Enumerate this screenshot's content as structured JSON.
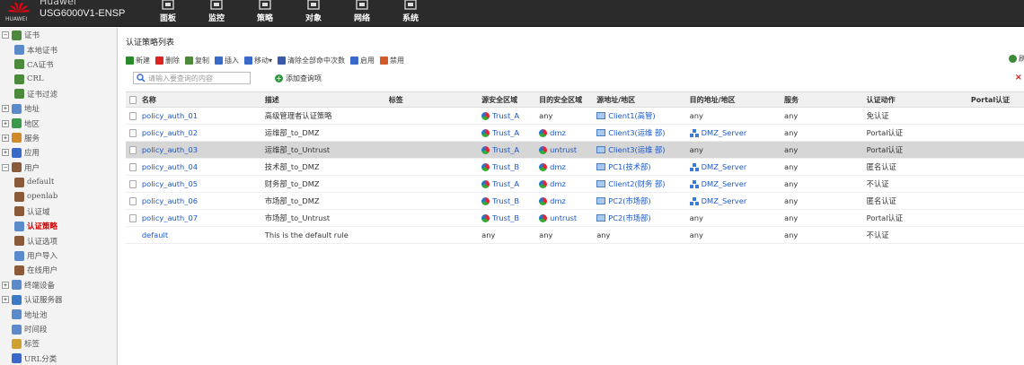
{
  "header": {
    "brand_top": "Huawei",
    "logo_text": "HUAWEI",
    "device": "USG6000V1-ENSP",
    "nav": [
      {
        "label": "面板",
        "icon": "dashboard-icon"
      },
      {
        "label": "监控",
        "icon": "monitor-icon"
      },
      {
        "label": "策略",
        "icon": "policy-icon"
      },
      {
        "label": "对象",
        "icon": "object-icon"
      },
      {
        "label": "网络",
        "icon": "network-icon"
      },
      {
        "label": "系统",
        "icon": "system-icon"
      }
    ]
  },
  "sidebar": {
    "items": [
      {
        "label": "证书",
        "level": 0,
        "exp": "−",
        "icon": "certificate-icon",
        "color": "#4a8a3a"
      },
      {
        "label": "本地证书",
        "level": 1,
        "icon": "local-cert-icon",
        "color": "#5a8ac9"
      },
      {
        "label": "CA证书",
        "level": 1,
        "icon": "ca-cert-icon",
        "color": "#4a8a3a"
      },
      {
        "label": "CRL",
        "level": 1,
        "icon": "crl-icon",
        "color": "#4a8a3a"
      },
      {
        "label": "证书过滤",
        "level": 1,
        "icon": "cert-filter-icon",
        "color": "#4a8a3a"
      },
      {
        "label": "地址",
        "level": 0,
        "exp": "+",
        "icon": "address-icon",
        "color": "#5a8ac9"
      },
      {
        "label": "地区",
        "level": 0,
        "exp": "+",
        "icon": "region-icon",
        "color": "#3a9a4a"
      },
      {
        "label": "服务",
        "level": 0,
        "exp": "+",
        "icon": "service-icon",
        "color": "#d08a2a"
      },
      {
        "label": "应用",
        "level": 0,
        "exp": "+",
        "icon": "application-icon",
        "color": "#3a6ac9"
      },
      {
        "label": "用户",
        "level": 0,
        "exp": "−",
        "icon": "user-icon",
        "color": "#8a5a3a"
      },
      {
        "label": "default",
        "level": 1,
        "icon": "user-group-icon",
        "color": "#8a5a3a"
      },
      {
        "label": "openlab",
        "level": 1,
        "icon": "user-group-icon",
        "color": "#8a5a3a"
      },
      {
        "label": "认证域",
        "level": 1,
        "icon": "auth-domain-icon",
        "color": "#8a5a3a"
      },
      {
        "label": "认证策略",
        "level": 1,
        "icon": "auth-policy-icon",
        "color": "#5a8ac9",
        "active": true
      },
      {
        "label": "认证选项",
        "level": 1,
        "icon": "auth-option-icon",
        "color": "#8a5a3a"
      },
      {
        "label": "用户导入",
        "level": 1,
        "icon": "user-import-icon",
        "color": "#5a8ac9"
      },
      {
        "label": "在线用户",
        "level": 1,
        "icon": "online-user-icon",
        "color": "#8a5a3a"
      },
      {
        "label": "终端设备",
        "level": 0,
        "exp": "+",
        "icon": "terminal-device-icon",
        "color": "#5a8ac9"
      },
      {
        "label": "认证服务器",
        "level": 0,
        "exp": "+",
        "icon": "auth-server-icon",
        "color": "#3a7ac9"
      },
      {
        "label": "地址池",
        "level": 0,
        "icon": "address-pool-icon",
        "color": "#5a8ac9"
      },
      {
        "label": "时间段",
        "level": 0,
        "icon": "time-range-icon",
        "color": "#5a8ac9"
      },
      {
        "label": "标签",
        "level": 0,
        "icon": "tag-icon",
        "color": "#d0a030"
      },
      {
        "label": "URL分类",
        "level": 0,
        "icon": "url-category-icon",
        "color": "#3a6ac9"
      }
    ]
  },
  "main": {
    "title": "认证策略列表",
    "toolbar": [
      {
        "label": "新建",
        "icon": "add-icon",
        "color": "#2a8a2a"
      },
      {
        "label": "删除",
        "icon": "delete-icon",
        "color": "#d22"
      },
      {
        "label": "复制",
        "icon": "copy-icon",
        "color": "#4a8a3a"
      },
      {
        "label": "插入",
        "icon": "insert-icon",
        "color": "#3a6ac9"
      },
      {
        "label": "移动▾",
        "icon": "move-icon",
        "color": "#3a6ac9"
      },
      {
        "label": "清除全部命中次数",
        "icon": "clear-hits-icon",
        "color": "#3a5aa9"
      },
      {
        "label": "启用",
        "icon": "enable-icon",
        "color": "#3a6ac9"
      },
      {
        "label": "禁用",
        "icon": "disable-icon",
        "color": "#d05a2a"
      }
    ],
    "refresh_label": "刷",
    "search_placeholder": "请输入要查询的内容",
    "add_query_label": "添加查询项",
    "columns": [
      "名称",
      "描述",
      "标签",
      "源安全区域",
      "目的安全区域",
      "源地址/地区",
      "目的地址/地区",
      "服务",
      "认证动作",
      "Portal认证"
    ],
    "rows": [
      {
        "name": "policy_auth_01",
        "desc": "高级管理者认证策略",
        "tag": "",
        "src": "Trust_A",
        "src_icon": true,
        "dst": "any",
        "dst_icon": false,
        "saddr": "Client1(高管)",
        "saddr_icon": "pc",
        "daddr": "any",
        "daddr_icon": "",
        "svc": "any",
        "act": "免认证",
        "sel": false
      },
      {
        "name": "policy_auth_02",
        "desc": "运维部_to_DMZ",
        "tag": "",
        "src": "Trust_A",
        "src_icon": true,
        "dst": "dmz",
        "dst_icon": true,
        "saddr": "Client3(运维 部)",
        "saddr_icon": "pc",
        "daddr": "DMZ_Server",
        "daddr_icon": "srv",
        "svc": "any",
        "act": "Portal认证",
        "sel": false
      },
      {
        "name": "policy_auth_03",
        "desc": "运维部_to_Untrust",
        "tag": "",
        "src": "Trust_A",
        "src_icon": true,
        "dst": "untrust",
        "dst_icon": true,
        "saddr": "Client3(运维 部)",
        "saddr_icon": "pc",
        "daddr": "any",
        "daddr_icon": "",
        "svc": "any",
        "act": "Portal认证",
        "sel": true
      },
      {
        "name": "policy_auth_04",
        "desc": "技术部_to_DMZ",
        "tag": "",
        "src": "Trust_B",
        "src_icon": true,
        "dst": "dmz",
        "dst_icon": true,
        "saddr": "PC1(技术部)",
        "saddr_icon": "pc",
        "daddr": "DMZ_Server",
        "daddr_icon": "srv",
        "svc": "any",
        "act": "匿名认证",
        "sel": false
      },
      {
        "name": "policy_auth_05",
        "desc": "财务部_to_DMZ",
        "tag": "",
        "src": "Trust_A",
        "src_icon": true,
        "dst": "dmz",
        "dst_icon": true,
        "saddr": "Client2(财务 部)",
        "saddr_icon": "pc",
        "daddr": "DMZ_Server",
        "daddr_icon": "srv",
        "svc": "any",
        "act": "不认证",
        "sel": false
      },
      {
        "name": "policy_auth_06",
        "desc": "市场部_to_DMZ",
        "tag": "",
        "src": "Trust_B",
        "src_icon": true,
        "dst": "dmz",
        "dst_icon": true,
        "saddr": "PC2(市场部)",
        "saddr_icon": "pc",
        "daddr": "DMZ_Server",
        "daddr_icon": "srv",
        "svc": "any",
        "act": "匿名认证",
        "sel": false
      },
      {
        "name": "policy_auth_07",
        "desc": "市场部_to_Untrust",
        "tag": "",
        "src": "Trust_B",
        "src_icon": true,
        "dst": "untrust",
        "dst_icon": true,
        "saddr": "PC2(市场部)",
        "saddr_icon": "pc",
        "daddr": "any",
        "daddr_icon": "",
        "svc": "any",
        "act": "Portal认证",
        "sel": false
      },
      {
        "name": "default",
        "desc": "This is the default rule",
        "tag": "",
        "src": "any",
        "src_icon": false,
        "dst": "any",
        "dst_icon": false,
        "saddr": "any",
        "saddr_icon": "",
        "daddr": "any",
        "daddr_icon": "",
        "svc": "any",
        "act": "不认证",
        "sel": false,
        "nochk": true
      }
    ]
  }
}
